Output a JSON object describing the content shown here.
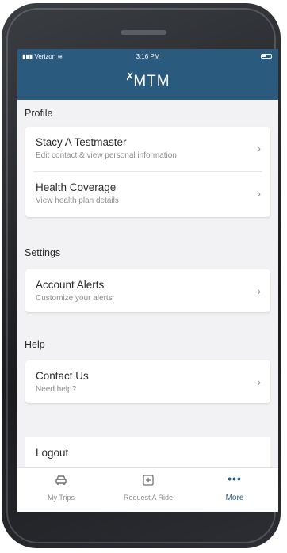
{
  "status_bar": {
    "carrier": "Verizon",
    "time": "3:16 PM"
  },
  "header": {
    "logo_text": "MTM",
    "logo_mark": "✗"
  },
  "sections": {
    "profile": {
      "title": "Profile",
      "items": [
        {
          "title": "Stacy A Testmaster",
          "subtitle": "Edit contact & view personal information"
        },
        {
          "title": "Health Coverage",
          "subtitle": "View health plan details"
        }
      ]
    },
    "settings": {
      "title": "Settings",
      "items": [
        {
          "title": "Account Alerts",
          "subtitle": "Customize your alerts"
        }
      ]
    },
    "help": {
      "title": "Help",
      "items": [
        {
          "title": "Contact Us",
          "subtitle": "Need help?"
        }
      ]
    }
  },
  "logout": {
    "label": "Logout"
  },
  "tabbar": {
    "tabs": [
      {
        "label": "My Trips",
        "icon": "car-icon"
      },
      {
        "label": "Request A Ride",
        "icon": "plus-square-icon"
      },
      {
        "label": "More",
        "icon": "more-dots-icon",
        "active": true
      }
    ]
  },
  "colors": {
    "brand": "#2a5a7d",
    "background": "#f2f2f4",
    "subtitle": "#8a8d91"
  }
}
